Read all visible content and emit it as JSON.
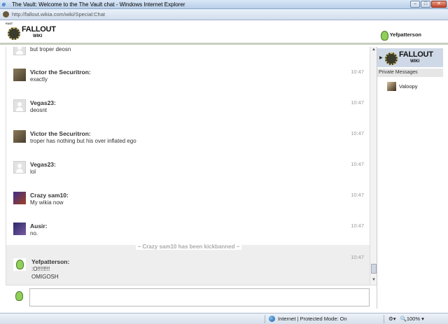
{
  "window": {
    "title": "The Vault: Welcome to the The Vault chat - Windows Internet Explorer",
    "url": "http://fallout.wikia.com/wiki/Special:Chat",
    "min_glyph": "–",
    "max_glyph": "□",
    "close_glyph": "✕"
  },
  "header": {
    "tag": "FAST",
    "logo_title": "FALLOUT",
    "logo_sub": "WIKI",
    "current_user": "Yefpatterson"
  },
  "messages": [
    {
      "user": "",
      "text": "but troper deosn",
      "time": ""
    },
    {
      "user": "Victor the Securitron:",
      "text": "exactly",
      "time": "10:47"
    },
    {
      "user": "Vegas23:",
      "text": "deosnt",
      "time": "10:47"
    },
    {
      "user": "Victor the Securitron:",
      "text": "troper has nothing but his over inflated ego",
      "time": "10:47"
    },
    {
      "user": "Vegas23:",
      "text": "lol",
      "time": "10:47"
    },
    {
      "user": "Crazy sam10:",
      "text": "My wikia now",
      "time": "10:47"
    },
    {
      "user": "Ausir:",
      "text": "no.",
      "time": "10:47"
    },
    {
      "user": "Yefpatterson:",
      "text": ":O!!!!!!!!",
      "text2": "OMIGOSH",
      "time": "10:47"
    }
  ],
  "inline_alert": "~ Crazy sam10 has been kickbanned ~",
  "input": {
    "value": "",
    "placeholder": ""
  },
  "rail": {
    "room_logo_title": "FALLOUT",
    "room_logo_sub": "WIKI",
    "private_messages_label": "Private Messages",
    "pm_user": "Valoopy"
  },
  "statusbar": {
    "zone": "Internet | Protected Mode: On",
    "zoom": "100%"
  }
}
